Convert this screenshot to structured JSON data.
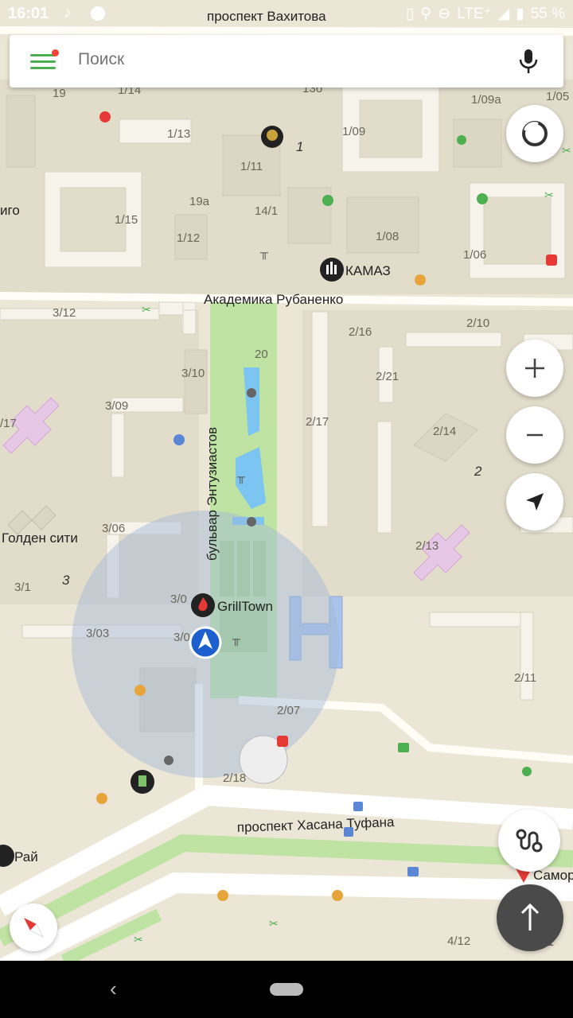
{
  "status": {
    "time": "16:01",
    "signal": "LTE⁺",
    "battery": "55 %"
  },
  "search": {
    "placeholder": "Поиск"
  },
  "streets": {
    "top": "проспект Вахитова",
    "rubanenko": "Академика Рубаненко",
    "boulevard": "бульвар Энтузиастов",
    "tufan": "проспект Хасана Туфана"
  },
  "places": {
    "kamaz": "КАМАЗ",
    "grilltown": "GrillTown",
    "golden_city": "Голден сити",
    "ray": "Рай",
    "samor": "Самор",
    "igo": "иго"
  },
  "buildings": [
    "19",
    "1/14",
    "13б",
    "1/09а",
    "1/05",
    "1/13",
    "1",
    "1/09",
    "1/11",
    "19а",
    "14/1",
    "1/15",
    "1/12",
    "1/08",
    "1/06",
    "3/12",
    "20",
    "2/16",
    "2/10",
    "3/10",
    "2/21",
    "3/09",
    "2/17",
    "2/14",
    "/17",
    "2",
    "3/06",
    "2/13",
    "3",
    "3/1",
    "3/0",
    "3/03",
    "3/0",
    "2/11",
    "2/07",
    "2/18",
    "4/12",
    "4/11"
  ],
  "icons": {
    "menu": "hamburger-icon",
    "mic": "microphone-icon",
    "layers": "layers-icon",
    "zoom_in": "plus-icon",
    "zoom_out": "minus-icon",
    "locate": "location-arrow-icon",
    "route": "route-icon",
    "compass": "compass-icon",
    "go": "arrow-up-icon"
  },
  "colors": {
    "accent": "#4caf50",
    "badge": "#f44336",
    "me": "#1e5fcf",
    "park": "#bfe3a2",
    "water": "#7cc4f2"
  }
}
